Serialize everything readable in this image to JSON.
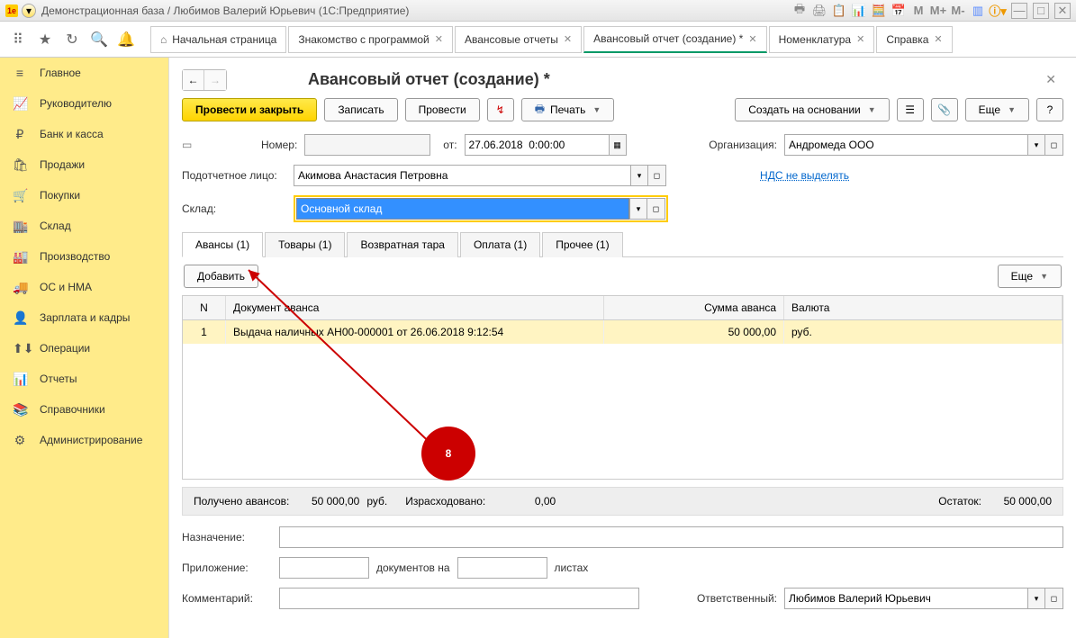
{
  "titlebar": {
    "title": "Демонстрационная база / Любимов Валерий Юрьевич  (1С:Предприятие)"
  },
  "toolbar_tabs": [
    {
      "label": "Начальная страница",
      "home": true,
      "closable": false,
      "active": false
    },
    {
      "label": "Знакомство с программой",
      "closable": true,
      "active": false
    },
    {
      "label": "Авансовые отчеты",
      "closable": true,
      "active": false
    },
    {
      "label": "Авансовый отчет (создание) *",
      "closable": true,
      "active": true
    },
    {
      "label": "Номенклатура",
      "closable": true,
      "active": false
    },
    {
      "label": "Справка",
      "closable": true,
      "active": false
    }
  ],
  "sidebar": [
    {
      "icon": "≡",
      "label": "Главное"
    },
    {
      "icon": "📈",
      "label": "Руководителю"
    },
    {
      "icon": "₽",
      "label": "Банк и касса"
    },
    {
      "icon": "🛍",
      "label": "Продажи"
    },
    {
      "icon": "🛒",
      "label": "Покупки"
    },
    {
      "icon": "🏬",
      "label": "Склад"
    },
    {
      "icon": "🏭",
      "label": "Производство"
    },
    {
      "icon": "🚚",
      "label": "ОС и НМА"
    },
    {
      "icon": "👤",
      "label": "Зарплата и кадры"
    },
    {
      "icon": "⬆⬇",
      "label": "Операции"
    },
    {
      "icon": "📊",
      "label": "Отчеты"
    },
    {
      "icon": "📚",
      "label": "Справочники"
    },
    {
      "icon": "⚙",
      "label": "Администрирование"
    }
  ],
  "page": {
    "title": "Авансовый отчет (создание) *",
    "actions": {
      "primary": "Провести и закрыть",
      "write": "Записать",
      "post": "Провести",
      "print": "Печать",
      "create_based": "Создать на основании",
      "more": "Еще"
    },
    "fields": {
      "number_label": "Номер:",
      "number_value": "",
      "from_label": "от:",
      "date_value": "27.06.2018  0:00:00",
      "org_label": "Организация:",
      "org_value": "Андромеда ООО",
      "person_label": "Подотчетное лицо:",
      "person_value": "Акимова Анастасия Петровна",
      "vat_link": "НДС не выделять",
      "warehouse_label": "Склад:",
      "warehouse_value": "Основной склад"
    },
    "doc_tabs": [
      {
        "label": "Авансы (1)",
        "active": true
      },
      {
        "label": "Товары (1)"
      },
      {
        "label": "Возвратная тара"
      },
      {
        "label": "Оплата (1)"
      },
      {
        "label": "Прочее (1)"
      }
    ],
    "add_btn": "Добавить",
    "more_btn": "Еще",
    "grid": {
      "headers": {
        "n": "N",
        "doc": "Документ аванса",
        "sum": "Сумма аванса",
        "cur": "Валюта"
      },
      "rows": [
        {
          "n": "1",
          "doc": "Выдача наличных АН00-000001 от 26.06.2018 9:12:54",
          "sum": "50 000,00",
          "cur": "руб."
        }
      ]
    },
    "totals": {
      "received_label": "Получено авансов:",
      "received_val": "50 000,00",
      "received_cur": "руб.",
      "spent_label": "Израсходовано:",
      "spent_val": "0,00",
      "rest_label": "Остаток:",
      "rest_val": "50 000,00"
    },
    "footer": {
      "purpose_label": "Назначение:",
      "purpose_val": "",
      "attachment_label": "Приложение:",
      "docs_on": "документов на",
      "sheets": "листах",
      "comment_label": "Комментарий:",
      "comment_val": "",
      "responsible_label": "Ответственный:",
      "responsible_val": "Любимов Валерий Юрьевич"
    }
  },
  "callout": {
    "number": "8"
  }
}
